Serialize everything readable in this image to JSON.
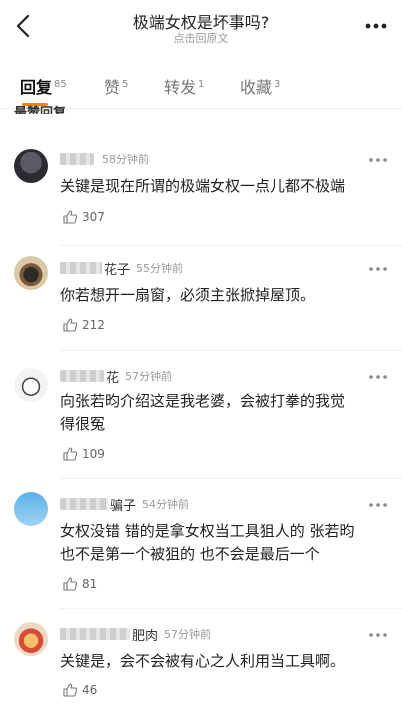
{
  "header": {
    "title": "极端女权是坏事吗?",
    "subtitle": "点击回原文"
  },
  "tabs": [
    {
      "label": "回复",
      "count": "85"
    },
    {
      "label": "赞",
      "count": "5"
    },
    {
      "label": "转发",
      "count": "1"
    },
    {
      "label": "收藏",
      "count": "3"
    }
  ],
  "section_title": "最赞回复",
  "comments": [
    {
      "name_suffix": "",
      "time": "58分钟前",
      "text_lines": [
        "关键是现在所谓的极端女权一点儿都不极端"
      ],
      "likes": "307"
    },
    {
      "name_suffix": "花子",
      "time": "55分钟前",
      "text_lines": [
        "你若想开一扇窗，必须主张掀掉屋顶。"
      ],
      "likes": "212"
    },
    {
      "name_suffix": "花",
      "time": "57分钟前",
      "text_lines": [
        "向张若昀介绍这是我老婆，会被打拳的我觉",
        "得很冤"
      ],
      "likes": "109"
    },
    {
      "name_suffix": "骗子",
      "time": "54分钟前",
      "text_lines": [
        "女权没错 错的是拿女权当工具狙人的 张若昀",
        "也不是第一个被狙的 也不会是最后一个"
      ],
      "likes": "81"
    },
    {
      "name_suffix": "肥肉",
      "time": "57分钟前",
      "text_lines": [
        "关键是，会不会被有心之人利用当工具啊。"
      ],
      "likes": "46"
    }
  ]
}
